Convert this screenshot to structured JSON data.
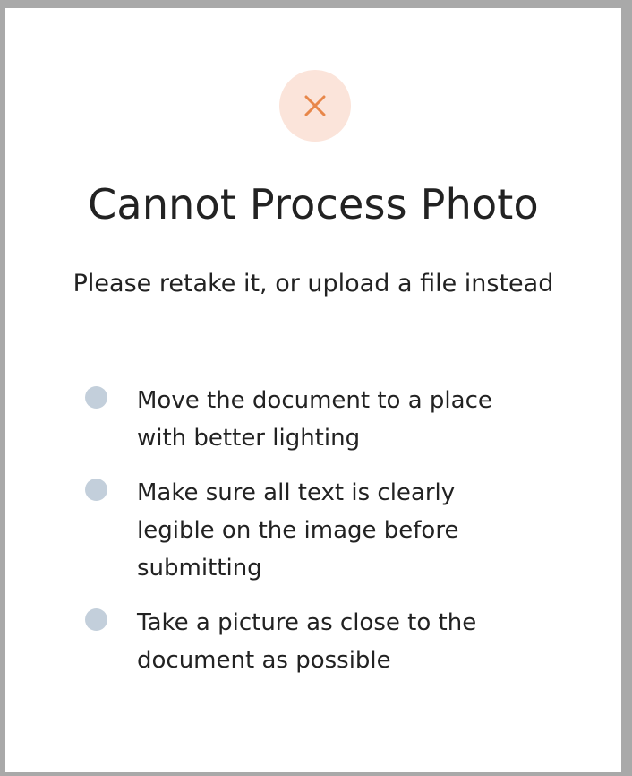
{
  "status": {
    "icon": "close-icon",
    "icon_color": "#e8874a",
    "icon_bg_color": "#fbe4da"
  },
  "title": "Cannot Process Photo",
  "subtitle": "Please retake it, or upload a file instead",
  "tips": [
    {
      "text": "Move the document to a place\nwith better lighting",
      "bullet_color": "#c3cfdb"
    },
    {
      "text": "Make sure all text is clearly\nlegible on the image before\nsubmitting",
      "bullet_color": "#c3cfdb"
    },
    {
      "text": "Take a picture as close to the\ndocument as possible",
      "bullet_color": "#c3cfdb"
    }
  ]
}
